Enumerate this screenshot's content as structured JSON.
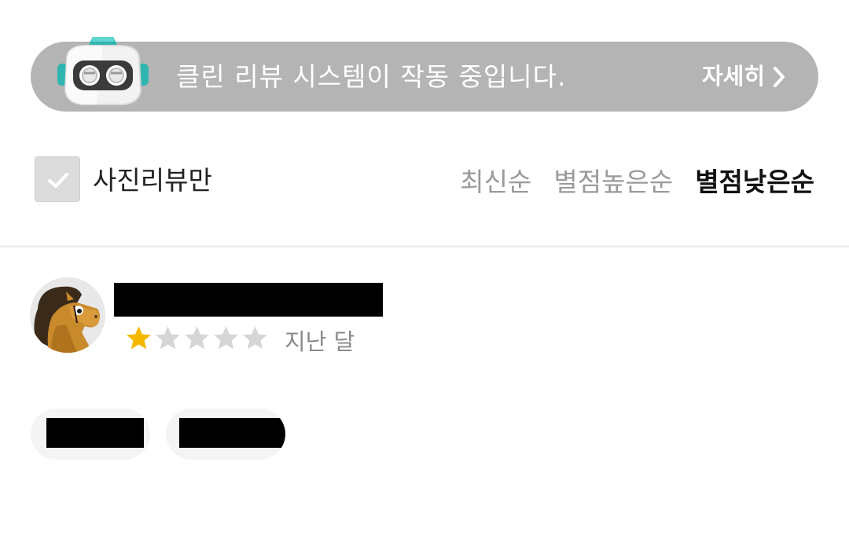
{
  "banner": {
    "text": "클린 리뷰 시스템이 작동 중입니다.",
    "more_label": "자세히",
    "background_color": "#b4b4b4",
    "icon": "robot-mascot-icon"
  },
  "filter": {
    "photo_only_label": "사진리뷰만",
    "photo_only_checked": false
  },
  "sort": {
    "options": [
      {
        "label": "최신순",
        "active": false
      },
      {
        "label": "별점높은순",
        "active": false
      },
      {
        "label": "별점낮은순",
        "active": true
      }
    ]
  },
  "review": {
    "avatar_icon": "horse-avatar-icon",
    "name": "",
    "rating": 1,
    "rating_max": 5,
    "star_color": "#f5b800",
    "date": "지난 달"
  },
  "tags": [
    {
      "label": ""
    },
    {
      "label": ""
    }
  ]
}
